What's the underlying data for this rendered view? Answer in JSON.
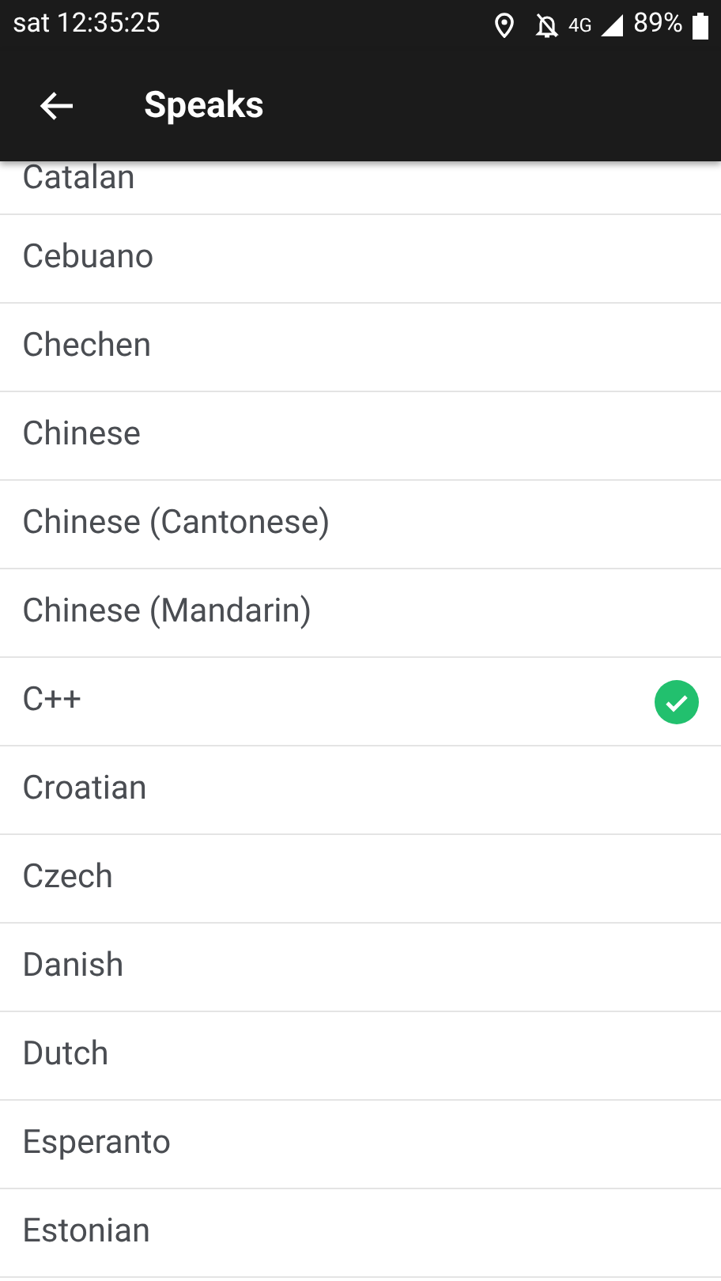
{
  "status_bar": {
    "time": "sat 12:35:25",
    "network": "4G",
    "battery": "89%"
  },
  "toolbar": {
    "title": "Speaks"
  },
  "languages": [
    {
      "label": "Catalan",
      "selected": false
    },
    {
      "label": "Cebuano",
      "selected": false
    },
    {
      "label": "Chechen",
      "selected": false
    },
    {
      "label": "Chinese",
      "selected": false
    },
    {
      "label": "Chinese (Cantonese)",
      "selected": false
    },
    {
      "label": "Chinese (Mandarin)",
      "selected": false
    },
    {
      "label": "C++",
      "selected": true
    },
    {
      "label": "Croatian",
      "selected": false
    },
    {
      "label": "Czech",
      "selected": false
    },
    {
      "label": "Danish",
      "selected": false
    },
    {
      "label": "Dutch",
      "selected": false
    },
    {
      "label": "Esperanto",
      "selected": false
    },
    {
      "label": "Estonian",
      "selected": false
    }
  ]
}
